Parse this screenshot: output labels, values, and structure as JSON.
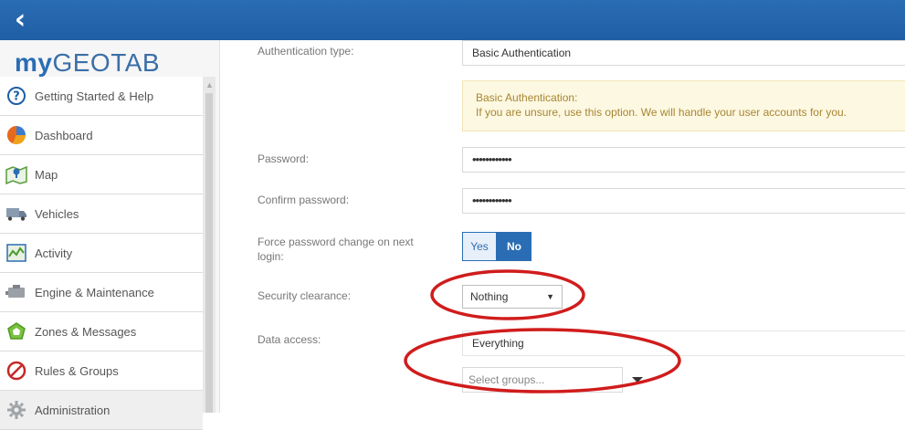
{
  "header": {
    "back_label": "back"
  },
  "logo": {
    "my": "my",
    "geotab": "GEOTAB"
  },
  "sidebar": {
    "items": [
      {
        "label": "Getting Started & Help",
        "icon": "help-circle-icon"
      },
      {
        "label": "Dashboard",
        "icon": "pie-chart-icon"
      },
      {
        "label": "Map",
        "icon": "map-icon"
      },
      {
        "label": "Vehicles",
        "icon": "truck-icon"
      },
      {
        "label": "Activity",
        "icon": "activity-chart-icon"
      },
      {
        "label": "Engine & Maintenance",
        "icon": "engine-icon"
      },
      {
        "label": "Zones & Messages",
        "icon": "zone-icon"
      },
      {
        "label": "Rules & Groups",
        "icon": "rules-icon"
      },
      {
        "label": "Administration",
        "icon": "gear-icon"
      }
    ]
  },
  "form": {
    "auth_type": {
      "label": "Authentication type:",
      "value": "Basic Authentication"
    },
    "info": {
      "title": "Basic Authentication:",
      "text": "If you are unsure, use this option. We will handle your user accounts for you."
    },
    "password": {
      "label": "Password:",
      "value": "••••••••••••"
    },
    "confirm_password": {
      "label": "Confirm password:",
      "value": "••••••••••••"
    },
    "force_change": {
      "label": "Force password change on next login:",
      "yes": "Yes",
      "no": "No",
      "selected": "No"
    },
    "security_clearance": {
      "label": "Security clearance:",
      "value": "Nothing"
    },
    "data_access": {
      "label": "Data access:",
      "value": "Everything",
      "groups_placeholder": "Select groups..."
    }
  },
  "colors": {
    "brand_blue": "#2a6db4",
    "info_bg": "#fdf8e1",
    "info_text": "#a78635",
    "annotation_red": "#d01c1c"
  }
}
